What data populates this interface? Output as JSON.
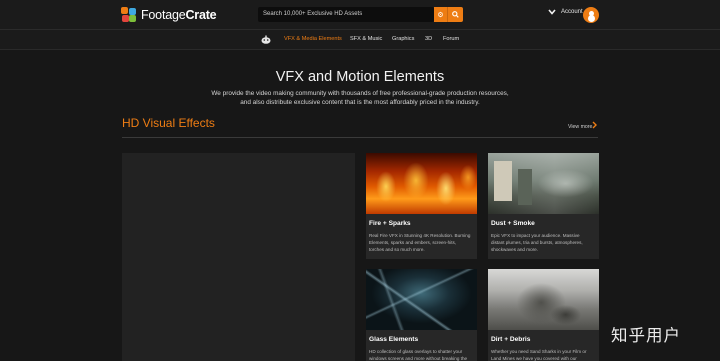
{
  "header": {
    "logo_light": "Footage",
    "logo_bold": "Crate",
    "search_placeholder": "Search 10,000+ Exclusive HD Assets",
    "account_label": "Account",
    "icons": [
      "logo-mark-icon",
      "gear-icon",
      "search-icon",
      "chevron-down-icon",
      "user-icon"
    ],
    "accent_color": "#ee7d14"
  },
  "nav": {
    "home_icon": "pumpkin-icon",
    "items": [
      {
        "label": "VFX & Media Elements",
        "active": true
      },
      {
        "label": "SFX & Music",
        "active": false
      },
      {
        "label": "Graphics",
        "active": false
      },
      {
        "label": "3D",
        "active": false
      },
      {
        "label": "Forum",
        "active": false
      }
    ]
  },
  "hero": {
    "title": "VFX and Motion Elements",
    "line1": "We provide the video making community with thousands of free professional-grade production resources,",
    "line2": "and also distribute exclusive content that is the most affordably priced in the industry."
  },
  "section": {
    "title": "HD Visual Effects",
    "view_more": "View more"
  },
  "cards": [
    {
      "title": "Fire + Sparks",
      "desc1": "Real Fire VFX in Stunning 4K Resolution. Burning",
      "desc2": "Elements, sparks and embers, screen-hits,",
      "desc3": "torches and so much more."
    },
    {
      "title": "Dust + Smoke",
      "desc1": "Epic VFX to impact your audience. Massive",
      "desc2": "distant plumes, tria and bursts, atmospheres,",
      "desc3": "shockwaves and more."
    },
    {
      "title": "Glass Elements",
      "desc1": "HD collection of glass overlays to shatter your",
      "desc2": "windows screens and more without breaking the",
      "desc3": ""
    },
    {
      "title": "Dirt + Debris",
      "desc1": "Whether you need Sand Sharks in your Film or",
      "desc2": "Land Mines we have you covered with our",
      "desc3": ""
    }
  ],
  "watermark": "知乎用户"
}
